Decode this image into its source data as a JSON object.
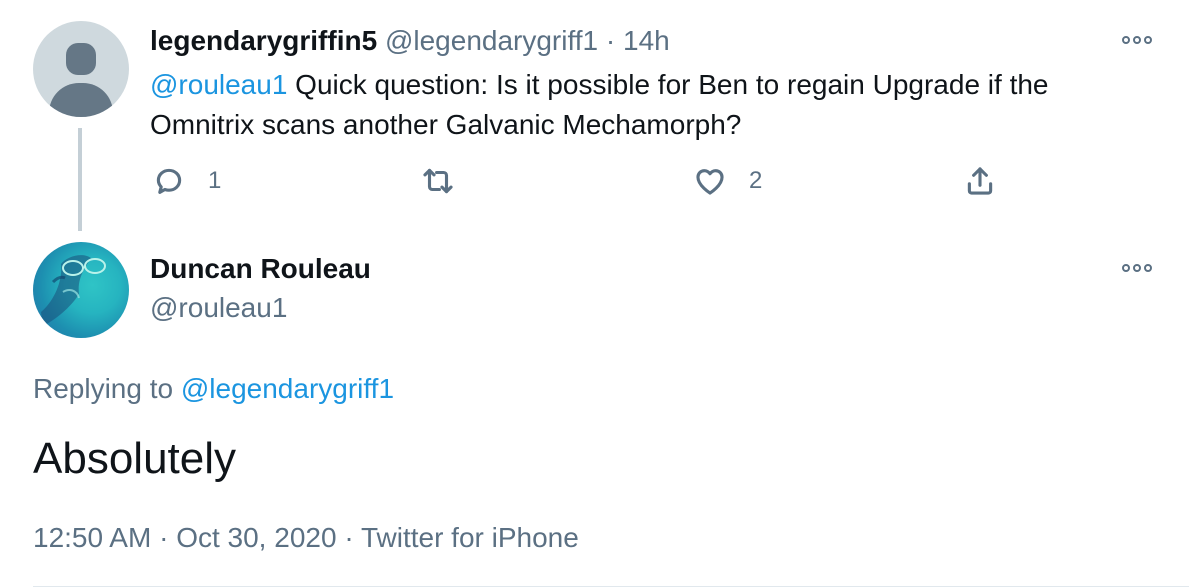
{
  "parent_tweet": {
    "display_name": "legendarygriffin5",
    "handle": "@legendarygriff1",
    "separator": "·",
    "time": "14h",
    "mention": "@rouleau1",
    "text": " Quick question: Is it possible for Ben to regain Upgrade if the Omnitrix scans another Galvanic Mechamorph?",
    "reply_count": "1",
    "like_count": "2",
    "icons": [
      "more-icon",
      "reply-icon",
      "retweet-icon",
      "like-icon",
      "share-icon"
    ]
  },
  "reply_tweet": {
    "display_name": "Duncan Rouleau",
    "handle": "@rouleau1",
    "replying_prefix": "Replying to ",
    "replying_to": "@legendarygriff1",
    "text": "Absolutely",
    "time": "12:50 AM",
    "separator1": "·",
    "date": "Oct 30, 2020",
    "separator2": "·",
    "source": "Twitter for iPhone"
  },
  "colors": {
    "link": "#1b95e0",
    "secondary_text": "#5b7083",
    "primary_text": "#0f1419",
    "thread_line": "#c4cfd6"
  }
}
